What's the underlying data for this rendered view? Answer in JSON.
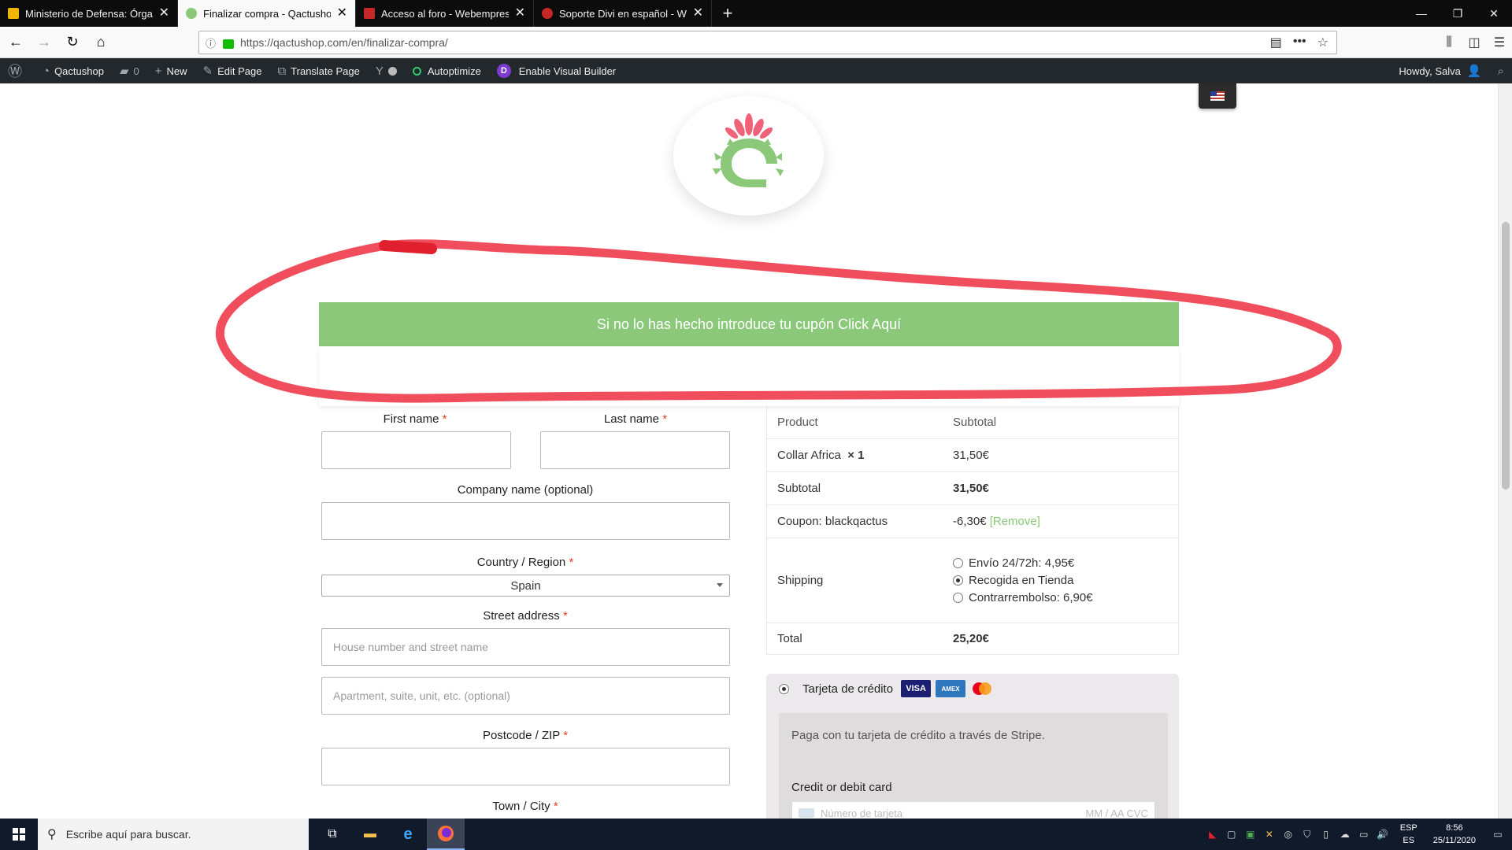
{
  "browser": {
    "tabs": [
      {
        "title": "Ministerio de Defensa: Órgano",
        "color": "#f2b705",
        "active": false
      },
      {
        "title": "Finalizar compra - Qactushop",
        "color": "#8bc87a",
        "active": true
      },
      {
        "title": "Acceso al foro - Webempresa E",
        "color": "#c62828",
        "active": false
      },
      {
        "title": "Soporte Divi en español - WPFa",
        "color": "#c62828",
        "active": false
      }
    ],
    "new_tab": "+",
    "url": "https://qactushop.com/en/finalizar-compra/"
  },
  "adminbar": {
    "site": "Qactushop",
    "comments": "0",
    "new": "New",
    "edit": "Edit Page",
    "translate": "Translate Page",
    "autoptimize": "Autoptimize",
    "visual_builder": "Enable Visual Builder",
    "howdy": "Howdy, Salva"
  },
  "coupon": {
    "text": "Si no lo has hecho introduce tu cupón Click Aquí"
  },
  "billing": {
    "first_name": "First name",
    "last_name": "Last name",
    "company": "Company name (optional)",
    "country_label": "Country / Region",
    "country_value": "Spain",
    "street_label": "Street address",
    "street_placeholder": "House number and street name",
    "apartment_placeholder": "Apartment, suite, unit, etc. (optional)",
    "postcode": "Postcode / ZIP",
    "city": "Town / City",
    "required": "*"
  },
  "order": {
    "head_product": "Product",
    "head_subtotal": "Subtotal",
    "item_name": "Collar Africa",
    "item_qty": "× 1",
    "item_price": "31,50€",
    "subtotal_label": "Subtotal",
    "subtotal_value": "31,50€",
    "coupon_label": "Coupon: blackqactus",
    "coupon_value": "-6,30€",
    "coupon_remove": "[Remove]",
    "shipping_label": "Shipping",
    "shipping_options": [
      {
        "label": "Envío 24/72h: 4,95€",
        "selected": false
      },
      {
        "label": "Recogida en Tienda",
        "selected": true
      },
      {
        "label": "Contrarrembolso: 6,90€",
        "selected": false
      }
    ],
    "total_label": "Total",
    "total_value": "25,20€"
  },
  "payment": {
    "method": "Tarjeta de crédito",
    "visa": "VISA",
    "amex": "AMEX",
    "description": "Paga con tu tarjeta de crédito a través de Stripe.",
    "cc_label": "Credit or debit card",
    "card_placeholder": "Número de tarjeta",
    "exp_cvc": "MM / AA  CVC"
  },
  "taskbar": {
    "search": "Escribe aquí para buscar.",
    "lang_top": "ESP",
    "lang_bottom": "ES",
    "time": "8:56",
    "date": "25/11/2020"
  }
}
